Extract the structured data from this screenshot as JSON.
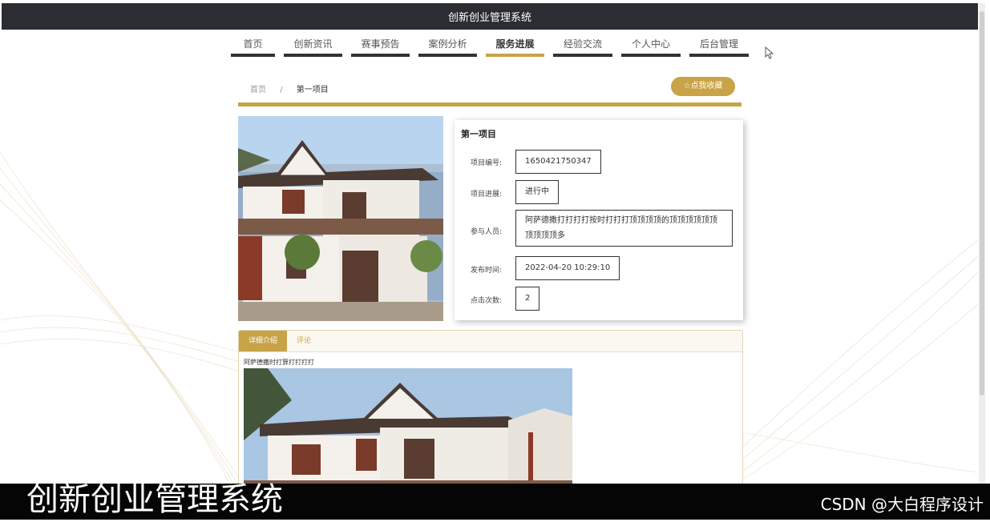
{
  "header": {
    "title": "创新创业管理系统"
  },
  "nav": {
    "items": [
      {
        "label": "首页",
        "active": false
      },
      {
        "label": "创新资讯",
        "active": false
      },
      {
        "label": "赛事预告",
        "active": false
      },
      {
        "label": "案例分析",
        "active": false
      },
      {
        "label": "服务进展",
        "active": true
      },
      {
        "label": "经验交流",
        "active": false
      },
      {
        "label": "个人中心",
        "active": false
      },
      {
        "label": "后台管理",
        "active": false
      }
    ]
  },
  "breadcrumb": {
    "home": "首页",
    "separator": "/",
    "current": "第一项目"
  },
  "favorite_button": "☆点我收藏",
  "project": {
    "title": "第一项目",
    "fields": [
      {
        "label": "项目编号:",
        "value": "1650421750347"
      },
      {
        "label": "项目进展:",
        "value": "进行中"
      },
      {
        "label": "参与人员:",
        "value": "阿萨德撒打打打打按时打打打顶顶顶顶的顶顶顶顶顶顶顶顶顶顶多"
      },
      {
        "label": "发布时间:",
        "value": "2022-04-20 10:29:10"
      },
      {
        "label": "点击次数:",
        "value": "2"
      }
    ]
  },
  "tabs": [
    {
      "label": "详细介绍",
      "active": true
    },
    {
      "label": "评论",
      "active": false
    }
  ],
  "detail": {
    "text": "阿萨德撒时打算打打打打"
  },
  "overlay": {
    "caption": "创新创业管理系统",
    "watermark": "CSDN @大白程序设计"
  },
  "colors": {
    "accent": "#c8a347",
    "header_bg": "#2b2d33",
    "nav_underline": "#333333"
  }
}
